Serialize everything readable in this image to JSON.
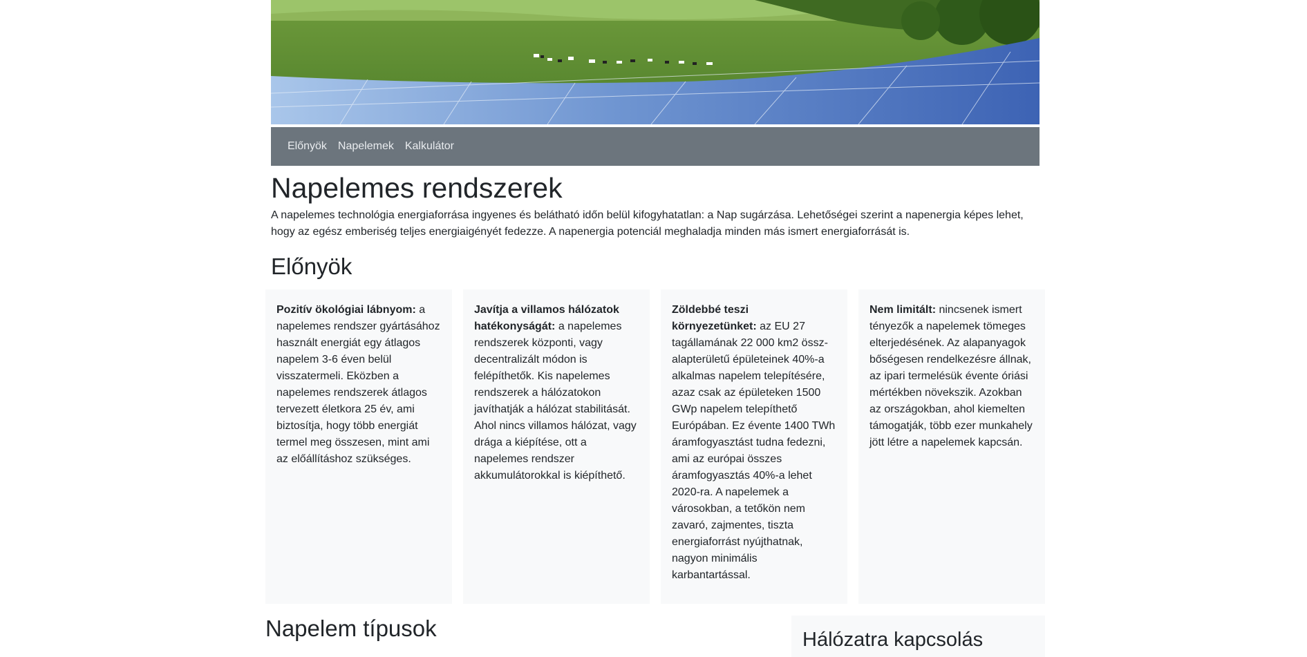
{
  "nav": {
    "items": [
      "Előnyök",
      "Napelemek",
      "Kalkulátor"
    ]
  },
  "header": {
    "title": "Napelemes rendszerek",
    "intro": "A napelemes technológia energiaforrása ingyenes és belátható időn belül kifogyhatatlan: a Nap sugárzása. Lehetőségei szerint a napenergia képes lehet, hogy az egész emberiség teljes energiaigényét fedezze. A napenergia potenciál meghaladja minden más ismert energiaforrását is."
  },
  "benefits": {
    "title": "Előnyök",
    "cards": [
      {
        "title": "Pozitív ökológiai lábnyom:",
        "text": " a napelemes rendszer gyártásához használt energiát egy átlagos napelem 3-6 éven belül visszatermeli. Eközben a napelemes rendszerek átlagos tervezett életkora 25 év, ami biztosítja, hogy több energiát termel meg összesen, mint ami az előállításhoz szükséges."
      },
      {
        "title": "Javítja a villamos hálózatok hatékonyságát:",
        "text": " a napelemes rendszerek központi, vagy decentralizált módon is felépíthetők. Kis napelemes rendszerek a hálózatokon javíthatják a hálózat stabilitását. Ahol nincs villamos hálózat, vagy drága a kiépítése, ott a napelemes rendszer akkumulátorokkal is kiépíthető."
      },
      {
        "title": "Zöldebbé teszi környezetünket:",
        "text": " az EU 27 tagállamának 22 000 km2 össz-alapterületű épületeinek 40%-a alkalmas napelem telepítésére, azaz csak az épületeken 1500 GWp napelem telepíthető Európában. Ez évente 1400 TWh áramfogyasztást tudna fedezni, ami az európai összes áramfogyasztás 40%-a lehet 2020-ra. A napelemek a városokban, a tetőkön nem zavaró, zajmentes, tiszta energiaforrást nyújthatnak, nagyon minimális karbantartással."
      },
      {
        "title": "Nem limitált:",
        "text": " nincsenek ismert tényezők a napelemek tömeges elterjedésének. Az alapanyagok bőségesen rendelkezésre állnak, az ipari termelésük évente óriási mértékben növekszik. Azokban az országokban, ahol kiemelten támogatják, több ezer munkahely jött létre a napelemek kapcsán."
      }
    ]
  },
  "types": {
    "title": "Napelem típusok"
  },
  "side": {
    "title": "Hálózatra kapcsolás"
  },
  "colors": {
    "navbar": "#6c757d",
    "card_bg": "#f8f9fa",
    "text": "#212529"
  }
}
